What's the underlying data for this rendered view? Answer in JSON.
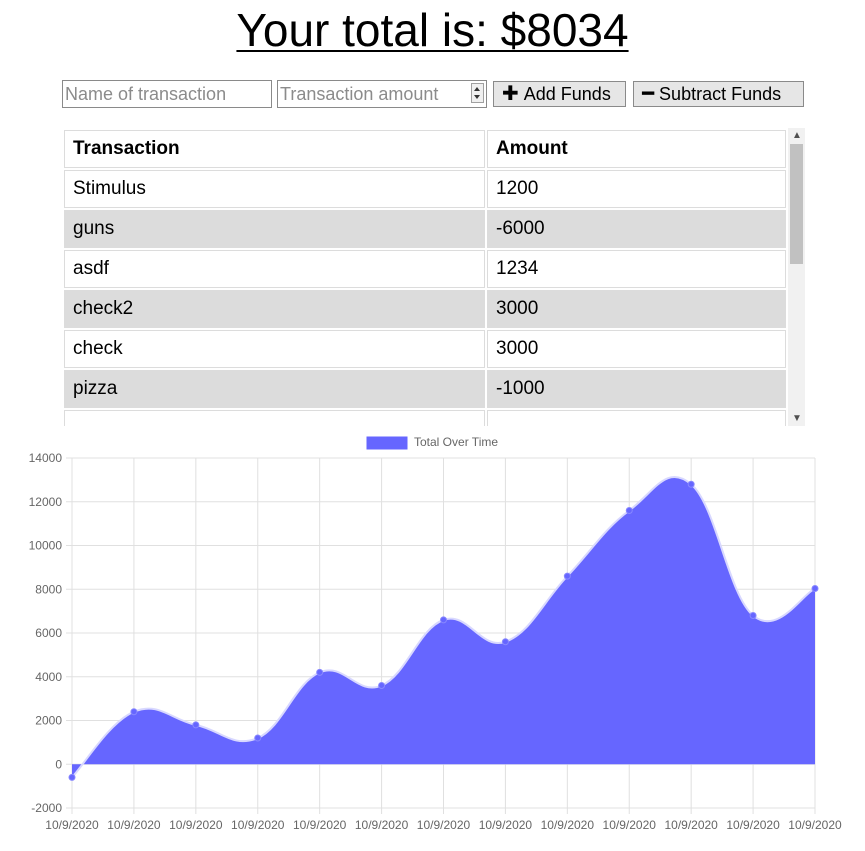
{
  "header": {
    "title": "Your total is: $8034"
  },
  "form": {
    "name_placeholder": "Name of transaction",
    "amount_placeholder": "Transaction amount",
    "add_label": "Add Funds",
    "subtract_label": "Subtract Funds"
  },
  "table": {
    "headers": [
      "Transaction",
      "Amount"
    ],
    "rows": [
      {
        "name": "Stimulus",
        "amount": "1200"
      },
      {
        "name": "guns",
        "amount": "-6000"
      },
      {
        "name": "asdf",
        "amount": "1234"
      },
      {
        "name": "check2",
        "amount": "3000"
      },
      {
        "name": "check",
        "amount": "3000"
      },
      {
        "name": "pizza",
        "amount": "-1000"
      }
    ]
  },
  "chart_data": {
    "type": "area",
    "title": "",
    "xlabel": "",
    "ylabel": "",
    "legend": {
      "position": "top",
      "entries": [
        "Total Over Time"
      ]
    },
    "fill_color": "#6666ff",
    "grid": true,
    "ylim": [
      -2000,
      14000
    ],
    "y_ticks": [
      14000,
      12000,
      10000,
      8000,
      6000,
      4000,
      2000,
      0,
      -2000
    ],
    "x": [
      "10/9/2020",
      "10/9/2020",
      "10/9/2020",
      "10/9/2020",
      "10/9/2020",
      "10/9/2020",
      "10/9/2020",
      "10/9/2020",
      "10/9/2020",
      "10/9/2020",
      "10/9/2020",
      "10/9/2020",
      "10/9/2020"
    ],
    "series": [
      {
        "name": "Total Over Time",
        "values": [
          -600,
          2400,
          1800,
          1200,
          4200,
          3600,
          6600,
          5600,
          8600,
          11600,
          12800,
          6800,
          8034
        ]
      }
    ]
  }
}
